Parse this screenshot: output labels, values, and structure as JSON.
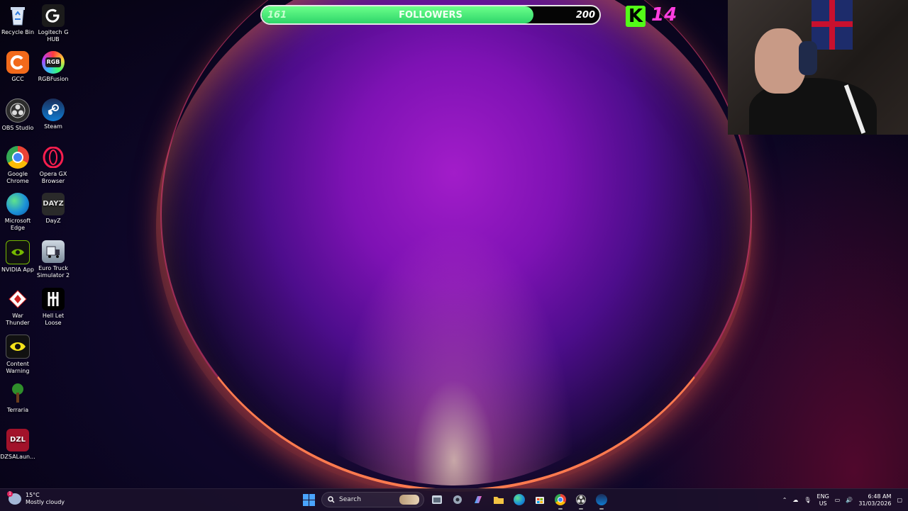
{
  "desktop_icons": [
    {
      "label": "Recycle Bin",
      "icon": "recycle-bin-icon"
    },
    {
      "label": "Logitech G HUB",
      "icon": "logitech-ghub-icon"
    },
    {
      "label": "GCC",
      "icon": "gcc-icon"
    },
    {
      "label": "RGBFusion",
      "icon": "rgbfusion-icon",
      "text": "RGB"
    },
    {
      "label": "OBS Studio",
      "icon": "obs-icon"
    },
    {
      "label": "Steam",
      "icon": "steam-icon"
    },
    {
      "label": "Google Chrome",
      "icon": "chrome-icon"
    },
    {
      "label": "Opera GX Browser",
      "icon": "opera-gx-icon"
    },
    {
      "label": "Microsoft Edge",
      "icon": "edge-icon"
    },
    {
      "label": "DayZ",
      "icon": "dayz-icon",
      "text": "DAYZ"
    },
    {
      "label": "NVIDIA App",
      "icon": "nvidia-icon"
    },
    {
      "label": "Euro Truck Simulator 2",
      "icon": "truck-icon"
    },
    {
      "label": "War Thunder",
      "icon": "war-thunder-icon"
    },
    {
      "label": "Hell Let Loose",
      "icon": "hell-let-loose-icon"
    },
    {
      "label": "Content Warning",
      "icon": "content-warning-icon"
    },
    {
      "label": "Terraria",
      "icon": "terraria-icon"
    },
    {
      "label": "DZSALaun...",
      "icon": "dzsa-icon",
      "text": "DZL"
    }
  ],
  "followers": {
    "current": "161",
    "label": "FOLLOWERS",
    "goal": "200",
    "progress": 0.805
  },
  "kick": {
    "logo": "K",
    "count": "14"
  },
  "weather": {
    "temp": "15°C",
    "condition": "Mostly cloudy",
    "badge": "1"
  },
  "taskbar": {
    "search_placeholder": "Search",
    "apps": [
      "file-explorer-icon",
      "settings-icon",
      "copilot-icon",
      "folder-icon",
      "edge-icon",
      "store-icon",
      "chrome-icon",
      "obs-icon",
      "steam-icon"
    ]
  },
  "tray": {
    "lang_top": "ENG",
    "lang_bottom": "US",
    "time": "6:48 AM",
    "date": "31/03/2026"
  },
  "colors": {
    "followers_fill": "#2ed56a",
    "kick_green": "#53fc18",
    "kick_count": "#ff3de0",
    "taskbar": "#1a102a"
  }
}
